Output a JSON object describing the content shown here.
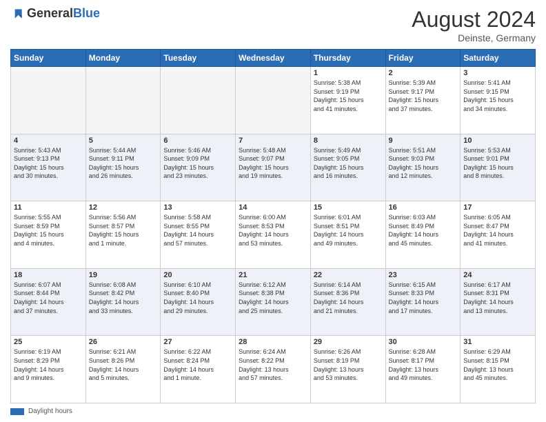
{
  "header": {
    "logo_general": "General",
    "logo_blue": "Blue",
    "month_year": "August 2024",
    "location": "Deinste, Germany"
  },
  "footer": {
    "daylight_label": "Daylight hours"
  },
  "weekdays": [
    "Sunday",
    "Monday",
    "Tuesday",
    "Wednesday",
    "Thursday",
    "Friday",
    "Saturday"
  ],
  "weeks": [
    [
      {
        "day": "",
        "info": ""
      },
      {
        "day": "",
        "info": ""
      },
      {
        "day": "",
        "info": ""
      },
      {
        "day": "",
        "info": ""
      },
      {
        "day": "1",
        "info": "Sunrise: 5:38 AM\nSunset: 9:19 PM\nDaylight: 15 hours\nand 41 minutes."
      },
      {
        "day": "2",
        "info": "Sunrise: 5:39 AM\nSunset: 9:17 PM\nDaylight: 15 hours\nand 37 minutes."
      },
      {
        "day": "3",
        "info": "Sunrise: 5:41 AM\nSunset: 9:15 PM\nDaylight: 15 hours\nand 34 minutes."
      }
    ],
    [
      {
        "day": "4",
        "info": "Sunrise: 5:43 AM\nSunset: 9:13 PM\nDaylight: 15 hours\nand 30 minutes."
      },
      {
        "day": "5",
        "info": "Sunrise: 5:44 AM\nSunset: 9:11 PM\nDaylight: 15 hours\nand 26 minutes."
      },
      {
        "day": "6",
        "info": "Sunrise: 5:46 AM\nSunset: 9:09 PM\nDaylight: 15 hours\nand 23 minutes."
      },
      {
        "day": "7",
        "info": "Sunrise: 5:48 AM\nSunset: 9:07 PM\nDaylight: 15 hours\nand 19 minutes."
      },
      {
        "day": "8",
        "info": "Sunrise: 5:49 AM\nSunset: 9:05 PM\nDaylight: 15 hours\nand 16 minutes."
      },
      {
        "day": "9",
        "info": "Sunrise: 5:51 AM\nSunset: 9:03 PM\nDaylight: 15 hours\nand 12 minutes."
      },
      {
        "day": "10",
        "info": "Sunrise: 5:53 AM\nSunset: 9:01 PM\nDaylight: 15 hours\nand 8 minutes."
      }
    ],
    [
      {
        "day": "11",
        "info": "Sunrise: 5:55 AM\nSunset: 8:59 PM\nDaylight: 15 hours\nand 4 minutes."
      },
      {
        "day": "12",
        "info": "Sunrise: 5:56 AM\nSunset: 8:57 PM\nDaylight: 15 hours\nand 1 minute."
      },
      {
        "day": "13",
        "info": "Sunrise: 5:58 AM\nSunset: 8:55 PM\nDaylight: 14 hours\nand 57 minutes."
      },
      {
        "day": "14",
        "info": "Sunrise: 6:00 AM\nSunset: 8:53 PM\nDaylight: 14 hours\nand 53 minutes."
      },
      {
        "day": "15",
        "info": "Sunrise: 6:01 AM\nSunset: 8:51 PM\nDaylight: 14 hours\nand 49 minutes."
      },
      {
        "day": "16",
        "info": "Sunrise: 6:03 AM\nSunset: 8:49 PM\nDaylight: 14 hours\nand 45 minutes."
      },
      {
        "day": "17",
        "info": "Sunrise: 6:05 AM\nSunset: 8:47 PM\nDaylight: 14 hours\nand 41 minutes."
      }
    ],
    [
      {
        "day": "18",
        "info": "Sunrise: 6:07 AM\nSunset: 8:44 PM\nDaylight: 14 hours\nand 37 minutes."
      },
      {
        "day": "19",
        "info": "Sunrise: 6:08 AM\nSunset: 8:42 PM\nDaylight: 14 hours\nand 33 minutes."
      },
      {
        "day": "20",
        "info": "Sunrise: 6:10 AM\nSunset: 8:40 PM\nDaylight: 14 hours\nand 29 minutes."
      },
      {
        "day": "21",
        "info": "Sunrise: 6:12 AM\nSunset: 8:38 PM\nDaylight: 14 hours\nand 25 minutes."
      },
      {
        "day": "22",
        "info": "Sunrise: 6:14 AM\nSunset: 8:36 PM\nDaylight: 14 hours\nand 21 minutes."
      },
      {
        "day": "23",
        "info": "Sunrise: 6:15 AM\nSunset: 8:33 PM\nDaylight: 14 hours\nand 17 minutes."
      },
      {
        "day": "24",
        "info": "Sunrise: 6:17 AM\nSunset: 8:31 PM\nDaylight: 14 hours\nand 13 minutes."
      }
    ],
    [
      {
        "day": "25",
        "info": "Sunrise: 6:19 AM\nSunset: 8:29 PM\nDaylight: 14 hours\nand 9 minutes."
      },
      {
        "day": "26",
        "info": "Sunrise: 6:21 AM\nSunset: 8:26 PM\nDaylight: 14 hours\nand 5 minutes."
      },
      {
        "day": "27",
        "info": "Sunrise: 6:22 AM\nSunset: 8:24 PM\nDaylight: 14 hours\nand 1 minute."
      },
      {
        "day": "28",
        "info": "Sunrise: 6:24 AM\nSunset: 8:22 PM\nDaylight: 13 hours\nand 57 minutes."
      },
      {
        "day": "29",
        "info": "Sunrise: 6:26 AM\nSunset: 8:19 PM\nDaylight: 13 hours\nand 53 minutes."
      },
      {
        "day": "30",
        "info": "Sunrise: 6:28 AM\nSunset: 8:17 PM\nDaylight: 13 hours\nand 49 minutes."
      },
      {
        "day": "31",
        "info": "Sunrise: 6:29 AM\nSunset: 8:15 PM\nDaylight: 13 hours\nand 45 minutes."
      }
    ]
  ]
}
